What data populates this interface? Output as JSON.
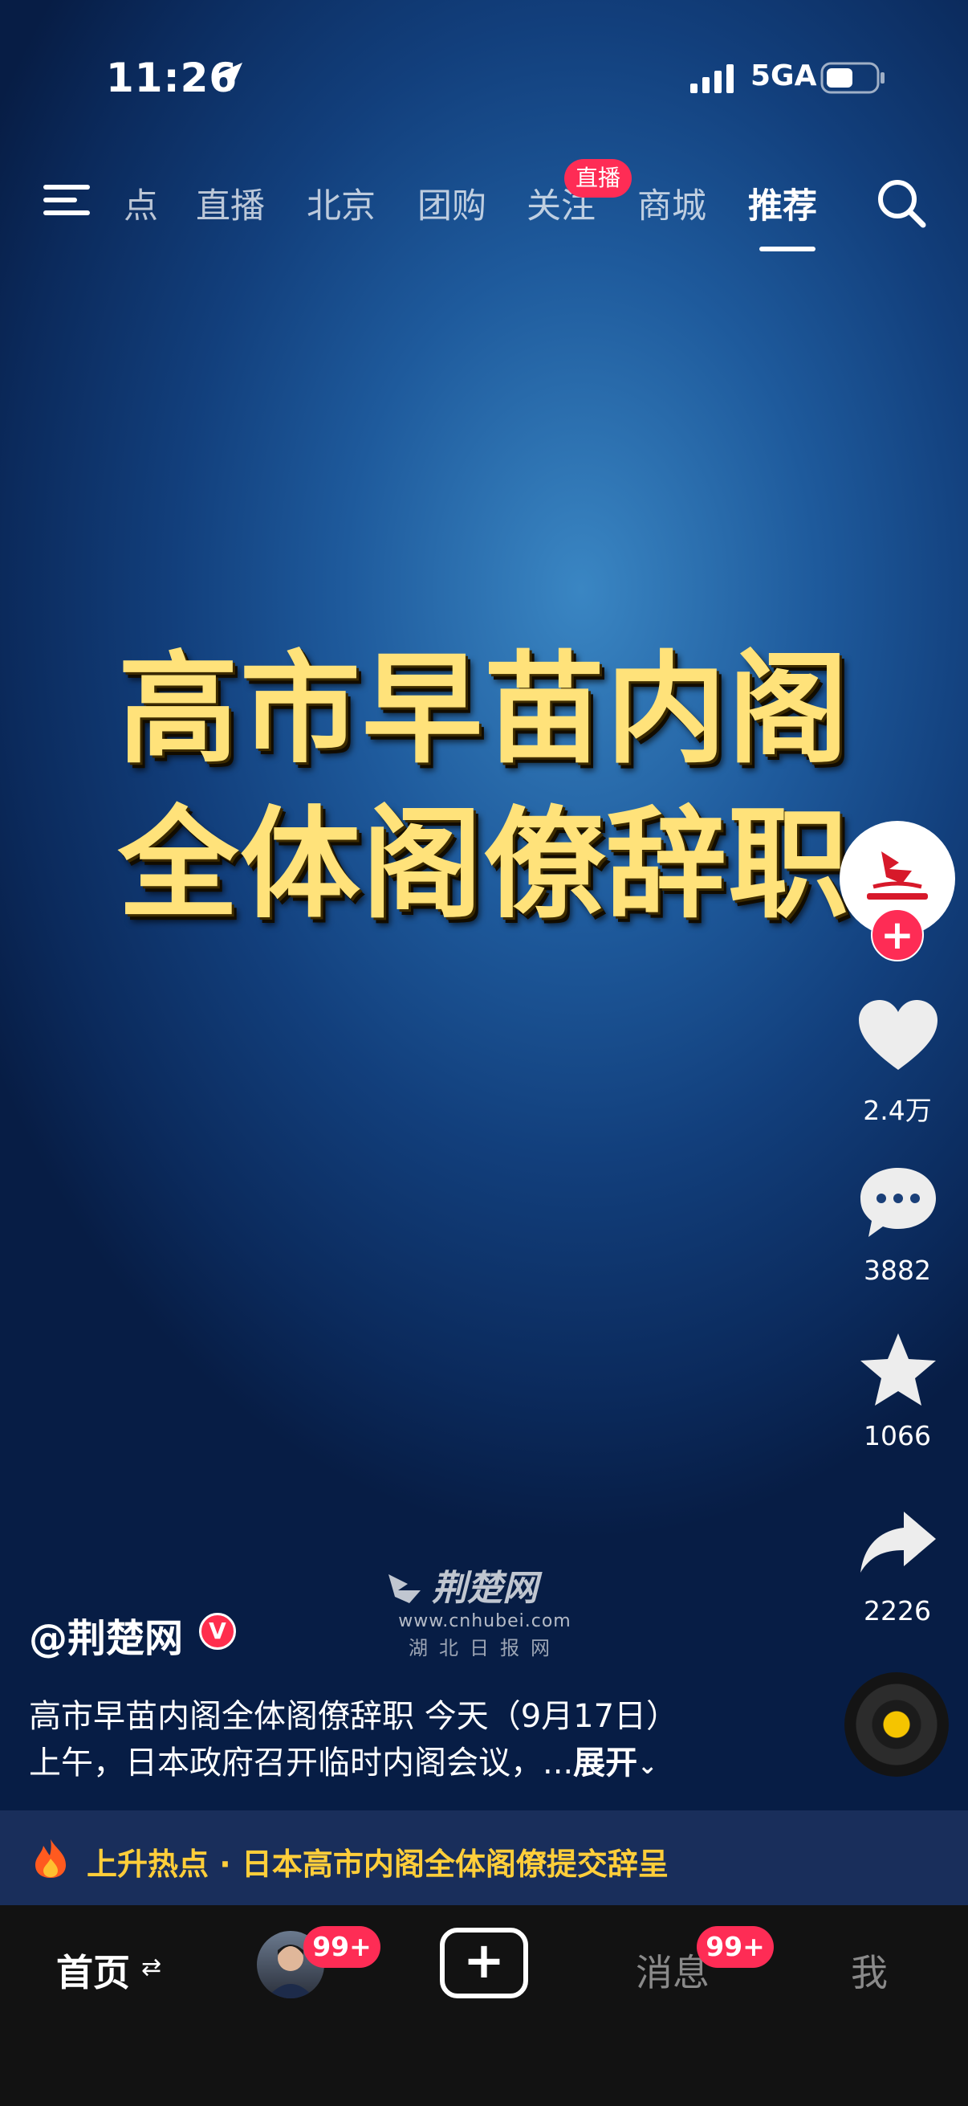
{
  "status_bar": {
    "time": "11:26",
    "network": "5GA"
  },
  "top_nav": {
    "tabs": [
      "点",
      "直播",
      "北京",
      "团购",
      "关注",
      "商城",
      "推荐"
    ],
    "active_tab": "推荐",
    "live_badge": "直播"
  },
  "video": {
    "headline_line1": "高市早苗内阁",
    "headline_line2": "全体阁僚辞职",
    "watermark_url": "www.cnhubei.com",
    "watermark_sub": "湖北日报网"
  },
  "right_rail": {
    "follow": "+",
    "likes": "2.4万",
    "comments": "3882",
    "favorites": "1066",
    "shares": "2226"
  },
  "caption": {
    "author": "@荆楚网",
    "verified": "V",
    "line1": "高市早苗内阁全体阁僚辞职 今天（9月17日）",
    "line2": "上午，日本政府召开临时内阁会议，...",
    "expand": "展开"
  },
  "hot_topic": {
    "text": "上升热点 · 日本高市内阁全体阁僚提交辞呈"
  },
  "bottom_nav": {
    "home": "首页",
    "friends_badge": "99+",
    "create": "+",
    "messages": "消息",
    "messages_badge": "99+",
    "me": "我"
  },
  "colors": {
    "accent": "#fe2c55",
    "headline": "#ffe27a",
    "hot_text": "#ffce3a"
  }
}
